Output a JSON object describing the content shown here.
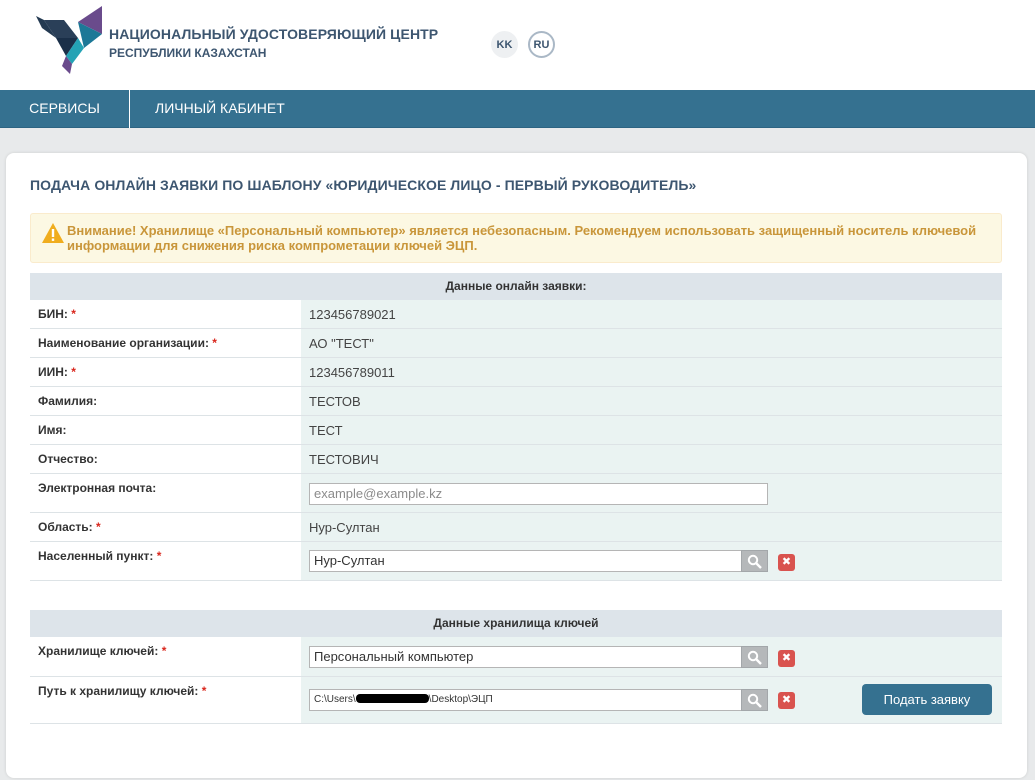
{
  "header": {
    "org_line1": "НАЦИОНАЛЬНЫЙ УДОСТОВЕРЯЮЩИЙ ЦЕНТР",
    "org_line2": "РЕСПУБЛИКИ КАЗАХСТАН",
    "lang_kk": "KK",
    "lang_ru": "RU"
  },
  "nav": {
    "services": "СЕРВИСЫ",
    "cabinet": "ЛИЧНЫЙ КАБИНЕТ"
  },
  "page": {
    "title": "ПОДАЧА ОНЛАЙН ЗАЯВКИ ПО ШАБЛОНУ «ЮРИДИЧЕСКОЕ ЛИЦО - ПЕРВЫЙ РУКОВОДИТЕЛЬ»",
    "alert": "Внимание! Хранилище «Персональный компьютер» является небезопасным. Рекомендуем использовать защищенный носитель ключевой информации для снижения риска компрометации ключей ЭЦП."
  },
  "application": {
    "heading": "Данные онлайн заявки:",
    "bin": {
      "label": "БИН:",
      "value": "123456789021"
    },
    "org_name": {
      "label": "Наименование организации:",
      "value": "АО \"ТЕСТ\""
    },
    "iin": {
      "label": "ИИН:",
      "value": "123456789011"
    },
    "surname": {
      "label": "Фамилия:",
      "value": "ТЕСТОВ"
    },
    "name": {
      "label": "Имя:",
      "value": "ТЕСТ"
    },
    "patronymic": {
      "label": "Отчество:",
      "value": "ТЕСТОВИЧ"
    },
    "email": {
      "label": "Электронная почта:",
      "placeholder": "example@example.kz"
    },
    "region": {
      "label": "Область:",
      "value": "Нур-Султан"
    },
    "locality": {
      "label": "Населенный пункт:",
      "value": "Нур-Султан"
    }
  },
  "keystore": {
    "heading": "Данные хранилища ключей",
    "storage": {
      "label": "Хранилище ключей:",
      "value": "Персональный компьютер"
    },
    "path": {
      "label": "Путь к хранилищу ключей:",
      "prefix": "C:\\Users\\",
      "suffix": "\\Desktop\\ЭЦП"
    }
  },
  "actions": {
    "submit": "Подать заявку",
    "clear_glyph": "✖",
    "required_mark": "*"
  },
  "colors": {
    "brand": "#357190",
    "alert_text": "#c9963a",
    "required": "#d9261c"
  }
}
